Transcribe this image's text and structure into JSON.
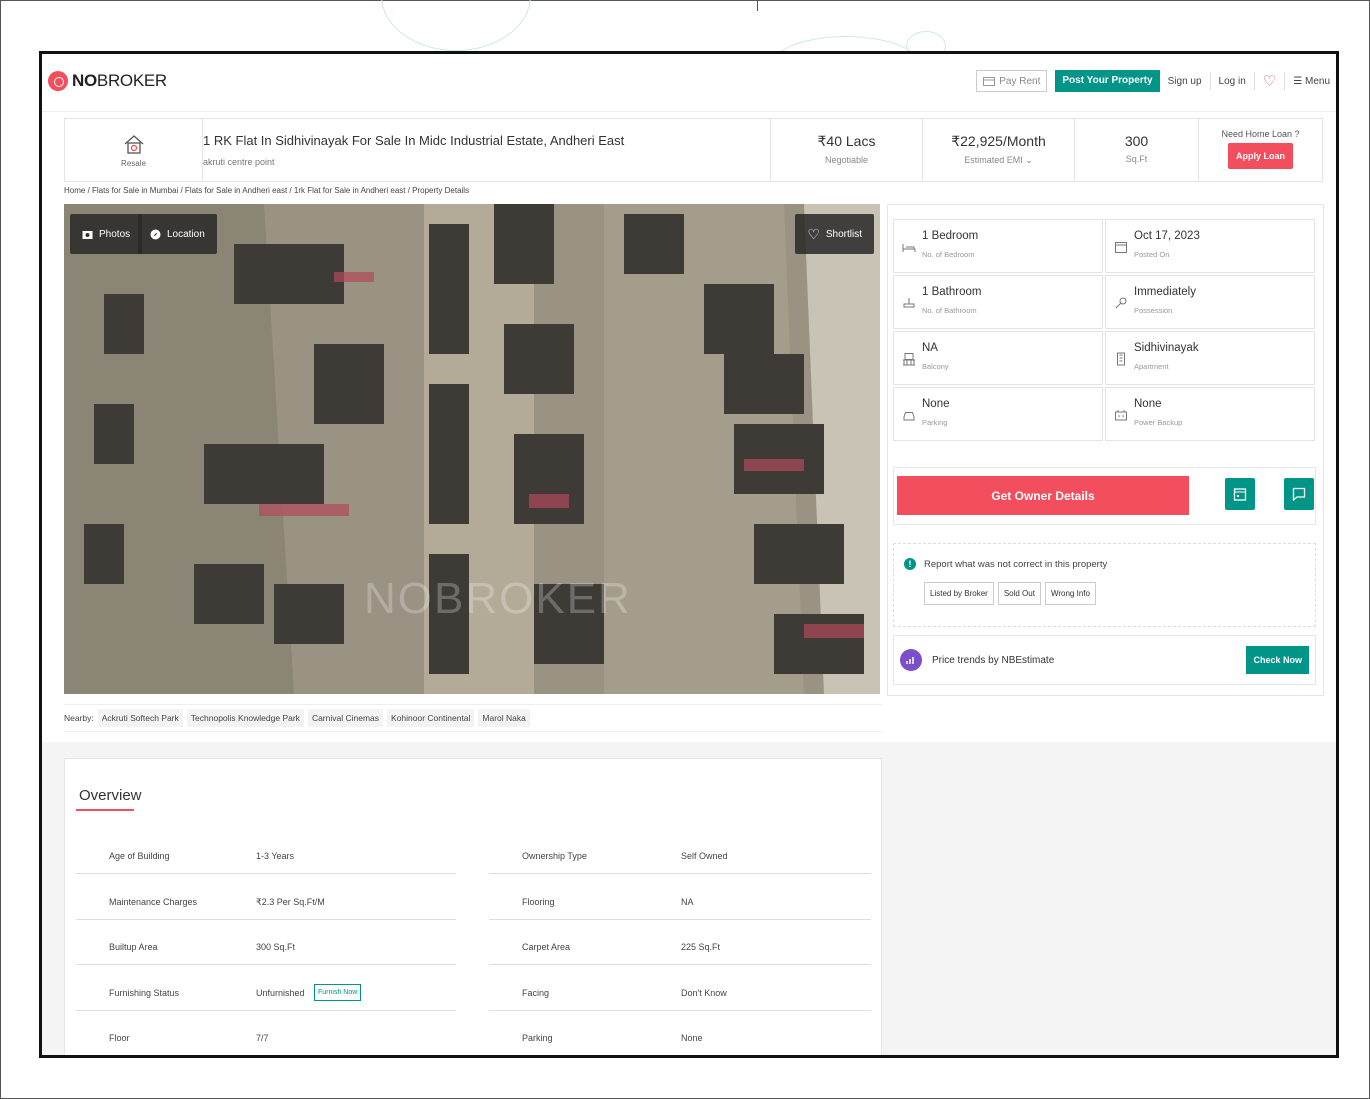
{
  "header": {
    "logo_bold": "NO",
    "logo_rest": "BROKER",
    "pay_rent": "Pay Rent",
    "post_property": "Post Your Property",
    "sign_up": "Sign up",
    "log_in": "Log in",
    "menu": "Menu"
  },
  "property": {
    "type_tag": "Resale",
    "title": "1 RK Flat In Sidhivinayak For Sale In Midc Industrial Estate, Andheri East",
    "subtitle": "akruti centre point",
    "price": "₹40 Lacs",
    "price_note": "Negotiable",
    "emi": "₹22,925/Month",
    "emi_note": "Estimated EMI ⌄",
    "area": "300",
    "area_unit": "Sq.Ft",
    "loan_question": "Need Home Loan ?",
    "apply_loan": "Apply Loan"
  },
  "breadcrumb": "Home / Flats for Sale in Mumbai / Flats for Sale in Andheri east / 1rk Flat for Sale in Andheri east / Property Details",
  "photo": {
    "photos_label": "Photos",
    "location_label": "Location",
    "shortlist_label": "Shortlist",
    "watermark": "NOBROKER"
  },
  "nearby": {
    "label": "Nearby:",
    "places": [
      "Ackruti Softech Park",
      "Technopolis Knowledge Park",
      "Carnival Cinemas",
      "Kohinoor Continental",
      "Marol Naka"
    ]
  },
  "details": [
    {
      "value": "1 Bedroom",
      "label": "No. of Bedroom",
      "icon": "bed-icon"
    },
    {
      "value": "Oct 17, 2023",
      "label": "Posted On",
      "icon": "calendar-icon"
    },
    {
      "value": "1 Bathroom",
      "label": "No. of Bathroom",
      "icon": "bathroom-icon"
    },
    {
      "value": "Immediately",
      "label": "Possession",
      "icon": "key-icon"
    },
    {
      "value": "NA",
      "label": "Balcony",
      "icon": "balcony-icon"
    },
    {
      "value": "Sidhivinayak",
      "label": "Apartment",
      "icon": "building-icon"
    },
    {
      "value": "None",
      "label": "Parking",
      "icon": "car-icon"
    },
    {
      "value": "None",
      "label": "Power Backup",
      "icon": "power-icon"
    }
  ],
  "cta": {
    "owner_details": "Get Owner Details"
  },
  "report": {
    "title": "Report what was not correct in this property",
    "buttons": [
      "Listed by Broker",
      "Sold Out",
      "Wrong Info"
    ]
  },
  "trends": {
    "title": "Price trends by NBEstimate",
    "check_now": "Check Now"
  },
  "overview": {
    "title": "Overview",
    "rows": [
      {
        "k1": "Age of Building",
        "v1": "1-3 Years",
        "k2": "Ownership Type",
        "v2": "Self Owned"
      },
      {
        "k1": "Maintenance Charges",
        "v1": "₹2.3 Per Sq.Ft/M",
        "k2": "Flooring",
        "v2": "NA"
      },
      {
        "k1": "Builtup Area",
        "v1": "300 Sq.Ft",
        "k2": "Carpet Area",
        "v2": "225 Sq.Ft"
      },
      {
        "k1": "Furnishing Status",
        "v1": "Unfurnished",
        "k2": "Facing",
        "v2": "Don't Know"
      },
      {
        "k1": "Floor",
        "v1": "7/7",
        "k2": "Parking",
        "v2": "None"
      }
    ],
    "furnish_now": "Furnish Now"
  },
  "colors": {
    "brand_red": "#f24e5d",
    "brand_teal": "#009587"
  }
}
